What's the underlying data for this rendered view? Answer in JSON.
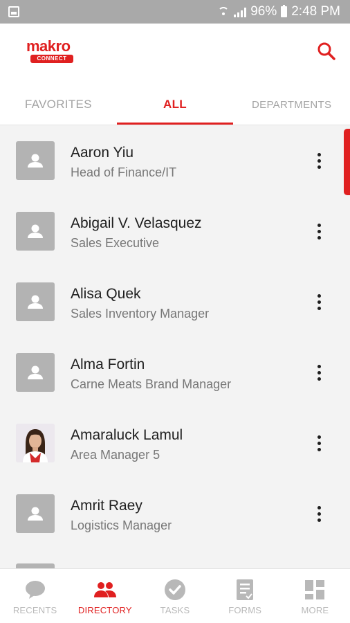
{
  "status_bar": {
    "battery": "96%",
    "time": "2:48 PM"
  },
  "header": {
    "logo_word": "makro",
    "logo_badge": "CONNECT",
    "search_icon": "search-icon"
  },
  "tabs": [
    {
      "label": "FAVORITES",
      "active": false
    },
    {
      "label": "ALL",
      "active": true
    },
    {
      "label": "DEPARTMENTS",
      "active": false
    }
  ],
  "contacts": [
    {
      "name": "Aaron Yiu",
      "title": "Head of Finance/IT",
      "avatar": "placeholder-person-icon"
    },
    {
      "name": "Abigail V. Velasquez",
      "title": "Sales Executive",
      "avatar": "placeholder-person-icon"
    },
    {
      "name": "Alisa Quek",
      "title": "Sales Inventory Manager",
      "avatar": "placeholder-person-icon"
    },
    {
      "name": "Alma Fortin",
      "title": "Carne Meats Brand Manager",
      "avatar": "placeholder-person-icon"
    },
    {
      "name": "Amaraluck Lamul",
      "title": "Area Manager 5",
      "avatar": "profile-photo"
    },
    {
      "name": "Amrit Raey",
      "title": "Logistics Manager",
      "avatar": "placeholder-person-icon"
    }
  ],
  "bottom_nav": [
    {
      "label": "RECENTS",
      "icon": "chat-bubble-icon",
      "active": false
    },
    {
      "label": "DIRECTORY",
      "icon": "people-icon",
      "active": true
    },
    {
      "label": "TASKS",
      "icon": "check-circle-icon",
      "active": false
    },
    {
      "label": "FORMS",
      "icon": "form-icon",
      "active": false
    },
    {
      "label": "MORE",
      "icon": "grid-icon",
      "active": false
    }
  ],
  "colors": {
    "accent": "#e02020",
    "status_bar": "#a9a9a9",
    "inactive": "#b8b8b8"
  }
}
